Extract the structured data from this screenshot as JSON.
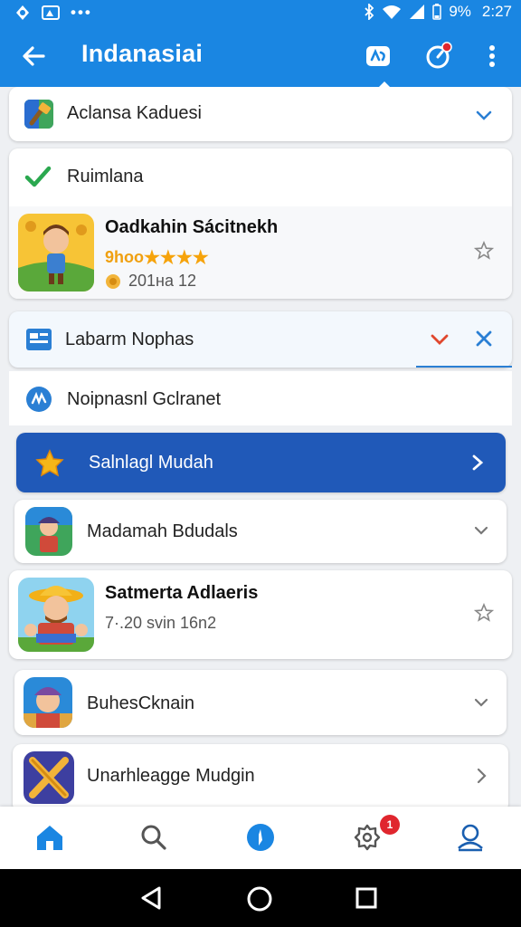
{
  "status_bar": {
    "battery": "9%",
    "time": "2:27"
  },
  "app_bar": {
    "title": "Indanasiai"
  },
  "sections": {
    "s1": {
      "label": "Aclansa Kaduesi"
    },
    "s2": {
      "label": "Ruimlana"
    },
    "game1": {
      "title": "Oadkahin Sácitnekh",
      "rating_prefix": "9hoo",
      "meta": "201на 12"
    },
    "s3": {
      "label": "Labarm Nophas"
    },
    "s4": {
      "label": "Noipnasnl Gclranet"
    },
    "s5": {
      "label": "Salnlagl Mudah"
    },
    "s6": {
      "label": "Madamah Bdudals"
    },
    "game2": {
      "title": "Satmerta Adlaeris",
      "meta": "7·.20 svin 16n2"
    },
    "s7": {
      "label": "BuhesCknain"
    },
    "s8": {
      "label": "Unarhleagge Mudgin"
    }
  },
  "bottom_nav": {
    "badge": "1"
  },
  "colors": {
    "primary": "#1a86e2",
    "selected_row": "#2059b8",
    "badge": "#e0262e",
    "star": "#f6a30b"
  },
  "icons": [
    "back-arrow-icon",
    "gamepad-icon",
    "timer-icon",
    "more-vert-icon",
    "home-icon",
    "search-icon",
    "compass-icon",
    "settings-icon",
    "profile-icon"
  ]
}
